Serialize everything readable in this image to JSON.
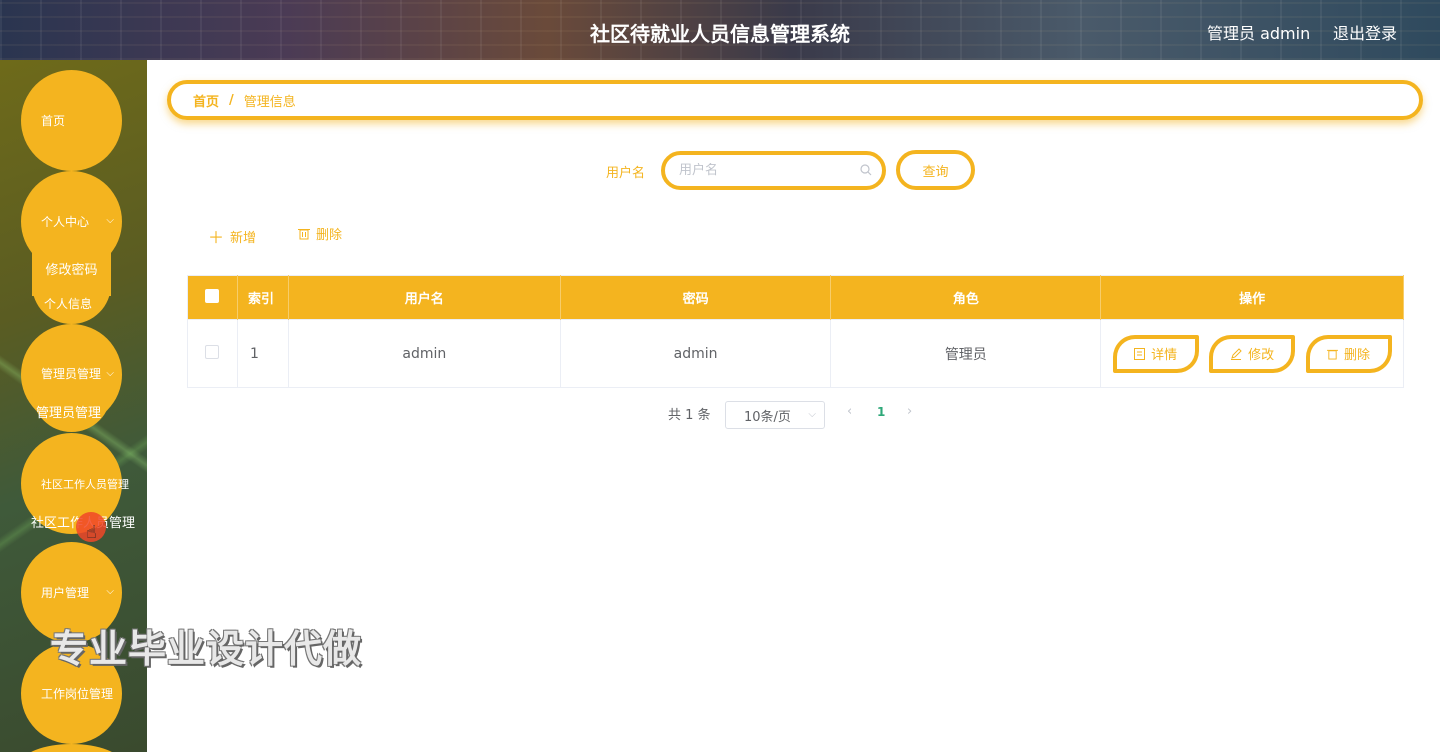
{
  "header": {
    "title": "社区待就业人员信息管理系统",
    "user_label": "管理员 admin",
    "logout_label": "退出登录"
  },
  "sidebar": {
    "items": [
      {
        "label": "首页"
      },
      {
        "label": "个人中心",
        "children": [
          "修改密码",
          "个人信息"
        ]
      },
      {
        "label": "管理员管理",
        "children": [
          "管理员管理"
        ]
      },
      {
        "label": "社区工作人员管理",
        "children": [
          "社区工作人员管理"
        ]
      },
      {
        "label": "用户管理"
      },
      {
        "label": "工作岗位管理"
      }
    ]
  },
  "watermark": "专业毕业设计代做",
  "breadcrumb": {
    "home": "首页",
    "separator": "/",
    "current": "管理信息"
  },
  "search": {
    "label": "用户名",
    "placeholder": "用户名",
    "value": "",
    "button": "查询"
  },
  "actions": {
    "add": "新增",
    "delete": "删除"
  },
  "table": {
    "columns": [
      "索引",
      "用户名",
      "密码",
      "角色",
      "操作"
    ],
    "rows": [
      {
        "index": "1",
        "username": "admin",
        "password": "admin",
        "role": "管理员"
      }
    ],
    "row_buttons": {
      "detail": "详情",
      "edit": "修改",
      "delete": "删除"
    }
  },
  "pagination": {
    "total": "共 1 条",
    "page_size": "10条/页",
    "current_page": "1"
  },
  "colors": {
    "accent": "#f4b41f",
    "page_active": "#2ea879"
  }
}
